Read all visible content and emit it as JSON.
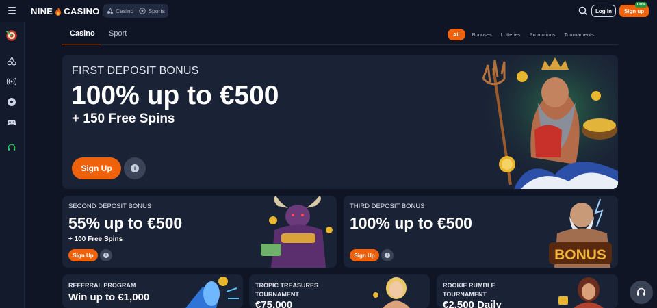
{
  "header": {
    "logo_left": "NINE",
    "logo_right": "CASINO",
    "mode_switch": [
      {
        "label": "Casino",
        "icon": "cherries-icon"
      },
      {
        "label": "Sports",
        "icon": "soccer-ball-icon"
      }
    ],
    "login_label": "Log in",
    "signup_label": "Sign up",
    "signup_badge": "100%"
  },
  "sidebar": {
    "items": [
      "dartboard-icon",
      "cherries-icon",
      "live-broadcast-icon",
      "soccer-ball-icon",
      "gamepad-icon",
      "support-headset-icon"
    ]
  },
  "tabs": {
    "casino": "Casino",
    "sport": "Sport"
  },
  "filters": [
    "All",
    "Bonuses",
    "Lotteries",
    "Promotions",
    "Tournaments"
  ],
  "hero": {
    "eyebrow": "FIRST DEPOSIT BONUS",
    "title": "100% up to €500",
    "subtitle": "+ 150 Free Spins",
    "button": "Sign Up",
    "info": "i"
  },
  "promo_cards": [
    {
      "eyebrow": "SECOND DEPOSIT BONUS",
      "title": "55% up to €500",
      "subtitle": "+ 100 Free Spins",
      "button": "Sign Up",
      "info": "i"
    },
    {
      "eyebrow": "THIRD DEPOSIT BONUS",
      "title": "100% up to €500",
      "button": "Sign Up",
      "info": "i",
      "art_text": "BONUS"
    }
  ],
  "bottom_cards": [
    {
      "eyebrow": "REFERRAL PROGRAM",
      "title": "Win up to €1,000"
    },
    {
      "eyebrow_line1": "TROPIC TREASURES",
      "eyebrow_line2": "TOURNAMENT",
      "title": "€75,000"
    },
    {
      "eyebrow_line1": "ROOKIE RUMBLE",
      "eyebrow_line2": "TOURNAMENT",
      "title": "€2,500 Daily"
    }
  ],
  "colors": {
    "accent": "#f0610c",
    "background": "#0f1524",
    "card": "#1a2235",
    "badge_green": "#1b9d3b"
  }
}
